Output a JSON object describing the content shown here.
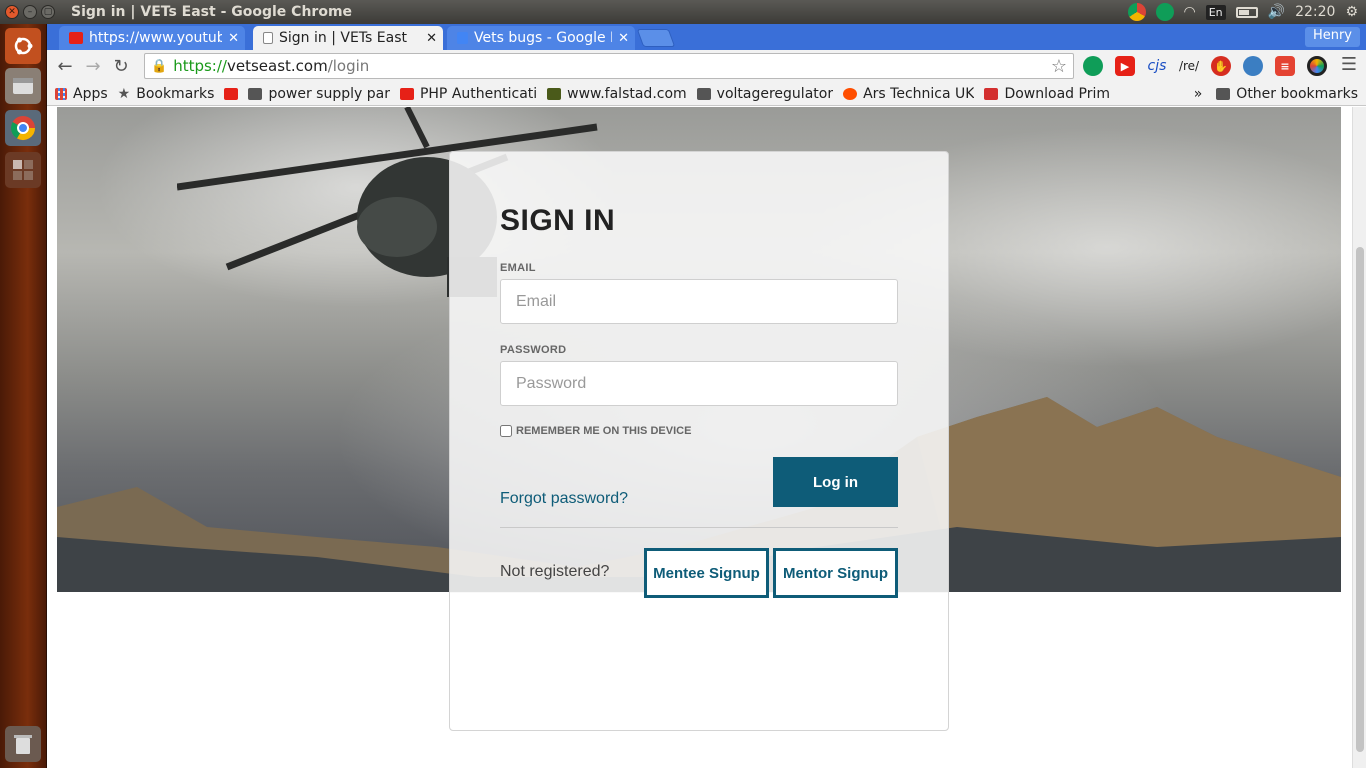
{
  "window": {
    "title": "Sign in | VETs East - Google Chrome",
    "clock": "22:20",
    "keyboard_layout": "En",
    "user": "Henry"
  },
  "tabs": [
    {
      "label": "https://www.youtube.com",
      "active": false,
      "favicon": "youtube-icon"
    },
    {
      "label": "Sign in | VETs East",
      "active": true,
      "favicon": "page-icon"
    },
    {
      "label": "Vets bugs - Google Docs",
      "active": false,
      "favicon": "docs-icon"
    }
  ],
  "address_bar": {
    "scheme": "https://",
    "host": "vetseast.com",
    "path": "/login"
  },
  "extensions": [
    {
      "name": "hangouts-icon",
      "label": ""
    },
    {
      "name": "youtube-ext-icon",
      "label": ""
    },
    {
      "name": "cjs-icon",
      "label": "cjs"
    },
    {
      "name": "regex-icon",
      "label": "/re/"
    },
    {
      "name": "adblock-icon",
      "label": ""
    },
    {
      "name": "chat-icon",
      "label": ""
    },
    {
      "name": "todoist-icon",
      "label": ""
    },
    {
      "name": "color-icon",
      "label": ""
    }
  ],
  "bookmarks": {
    "items": [
      {
        "label": "Apps",
        "icon": "apps-grid-icon"
      },
      {
        "label": "Bookmarks",
        "icon": "star-icon"
      },
      {
        "label": "",
        "icon": "youtube-icon"
      },
      {
        "label": "power supply par",
        "icon": "folder-icon"
      },
      {
        "label": "PHP Authenticati",
        "icon": "youtube-icon"
      },
      {
        "label": "www.falstad.com",
        "icon": "falstad-icon"
      },
      {
        "label": "voltageregulator",
        "icon": "folder-icon"
      },
      {
        "label": "Ars Technica UK",
        "icon": "ars-icon"
      },
      {
        "label": "Download Primer",
        "icon": "primer-icon"
      }
    ],
    "overflow": "»",
    "other": "Other bookmarks"
  },
  "signin": {
    "title": "SIGN IN",
    "email_label": "EMAIL",
    "email_placeholder": "Email",
    "password_label": "PASSWORD",
    "password_placeholder": "Password",
    "remember_label": "REMEMBER ME ON THIS DEVICE",
    "remember_checked": false,
    "login_button": "Log in",
    "forgot_link": "Forgot password?",
    "not_registered": "Not registered?",
    "mentee_signup": "Mentee Signup",
    "mentor_signup": "Mentor Signup"
  },
  "colors": {
    "brand": "#0e5c78",
    "tabstrip": "#3a6fd8",
    "launcher": "#7a2e0c"
  }
}
